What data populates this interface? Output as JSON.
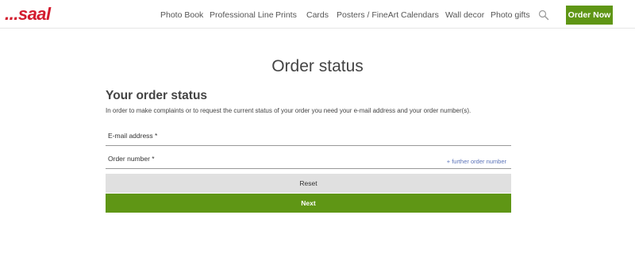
{
  "header": {
    "logo_text": "...saal",
    "nav": [
      {
        "label": "Photo Book"
      },
      {
        "label": "Professional Line"
      },
      {
        "label": "Prints"
      },
      {
        "label": "Cards"
      },
      {
        "label": "Posters / FineArt"
      },
      {
        "label": "Calendars"
      },
      {
        "label": "Wall decor"
      },
      {
        "label": "Photo gifts"
      }
    ],
    "search_icon": "search-icon",
    "order_now_label": "Order Now"
  },
  "main": {
    "page_title": "Order status",
    "section_title": "Your order status",
    "description": "In order to make complaints or to request the current status of your order you need your e-mail address and your order number(s).",
    "email_label": "E-mail address *",
    "email_value": "",
    "order_label": "Order number *",
    "order_value": "",
    "further_link": "+ further order number",
    "reset_label": "Reset",
    "next_label": "Next"
  },
  "colors": {
    "brand_red": "#d31b2e",
    "accent_green": "#5f9615",
    "reset_gray": "#e0e0e0",
    "link_blue": "#5a72b8"
  }
}
